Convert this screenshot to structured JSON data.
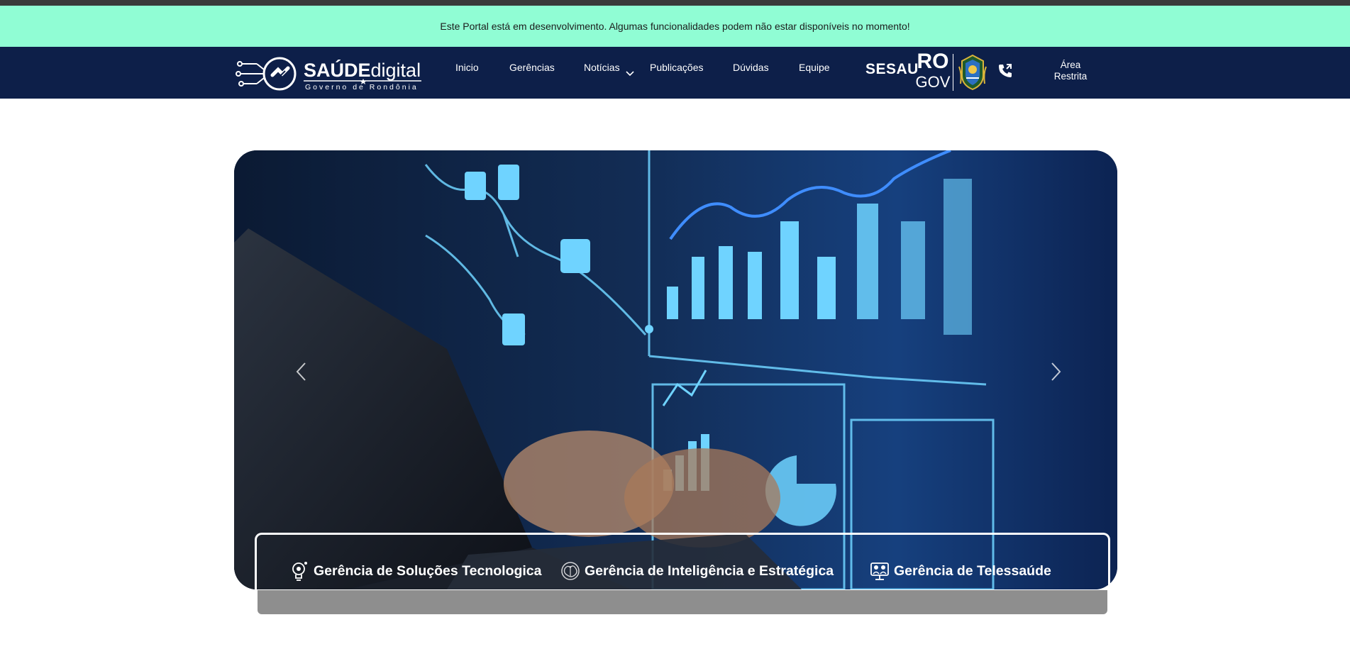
{
  "notice": {
    "text": "Este Portal está em desenvolvimento. Algumas funcionalidades podem não estar disponíveis no momento!"
  },
  "header": {
    "logo": {
      "brand_bold": "SAÚDE",
      "brand_light": "digital",
      "tagline": "Governo de Rondônia"
    },
    "nav": [
      {
        "label": "Inicio"
      },
      {
        "label": "Gerências"
      },
      {
        "label": "Notícias"
      },
      {
        "label": "Publicações"
      },
      {
        "label": "Dúvidas"
      },
      {
        "label": "Equipe"
      }
    ],
    "sesau": "SESAU",
    "rogov": {
      "ro": "RO",
      "gov": "GOV"
    },
    "area_restrita": {
      "line1": "Área",
      "line2": "Restrita"
    }
  },
  "carousel": {
    "prev_icon": "chevron-left-icon",
    "next_icon": "chevron-right-icon"
  },
  "gerencias": [
    {
      "label": "Gerência de Soluções Tecnologica",
      "icon": "lightbulb-gear-icon"
    },
    {
      "label": "Gerência de Inteligência e Estratégica",
      "icon": "brain-network-icon"
    },
    {
      "label": "Gerência de Telessaúde",
      "icon": "telehealth-doctor-icon"
    }
  ],
  "colors": {
    "notice_bg": "#90fdd4",
    "navbar_bg": "#0d1f49",
    "hero_accent": "#6fd3ff",
    "cards_shadow": "#8e8e8e"
  }
}
